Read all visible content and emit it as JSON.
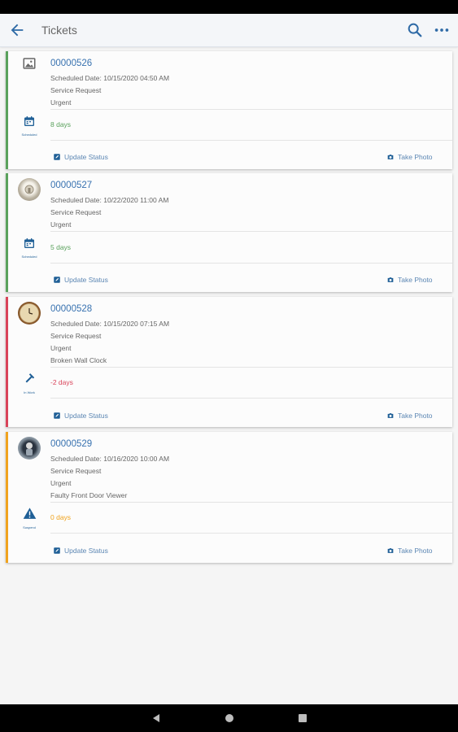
{
  "app": {
    "title": "Tickets"
  },
  "colors": {
    "green": "#5aa15c",
    "red": "#d9445a",
    "orange": "#f0a31e",
    "link": "#3872b0"
  },
  "tickets": [
    {
      "id": "00000526",
      "scheduled": "Scheduled Date: 10/15/2020 04:50 AM",
      "type": "Service Request",
      "priority": "Urgent",
      "description": "",
      "status_caption": "Scheduled",
      "status_icon": "calendar-icon",
      "days": "8 days",
      "update_label": "Update Status",
      "photo_label": "Take Photo"
    },
    {
      "id": "00000527",
      "scheduled": "Scheduled Date: 10/22/2020 11:00 AM",
      "type": "Service Request",
      "priority": "Urgent",
      "description": "",
      "status_caption": "Scheduled",
      "status_icon": "calendar-icon",
      "days": "5 days",
      "update_label": "Update Status",
      "photo_label": "Take Photo"
    },
    {
      "id": "00000528",
      "scheduled": "Scheduled Date: 10/15/2020 07:15 AM",
      "type": "Service Request",
      "priority": "Urgent",
      "description": "Broken Wall Clock",
      "status_caption": "In Work",
      "status_icon": "hammer-icon",
      "days": "-2 days",
      "update_label": "Update Status",
      "photo_label": "Take Photo"
    },
    {
      "id": "00000529",
      "scheduled": "Scheduled Date: 10/16/2020 10:00 AM",
      "type": "Service Request",
      "priority": "Urgent",
      "description": "Faulty Front Door Viewer",
      "status_caption": "Suspend",
      "status_icon": "warning-icon",
      "days": "0 days",
      "update_label": "Update Status",
      "photo_label": "Take Photo"
    }
  ]
}
